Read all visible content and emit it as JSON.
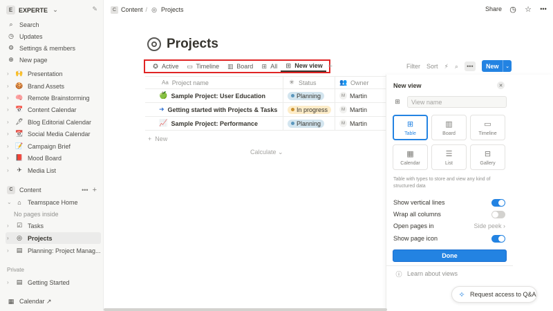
{
  "sidebar": {
    "workspace_badge": "E",
    "workspace_name": "EXPERTE",
    "top_items": [
      {
        "label": "Search",
        "icon": "⌕"
      },
      {
        "label": "Updates",
        "icon": "◷"
      },
      {
        "label": "Settings & members",
        "icon": "⚙"
      },
      {
        "label": "New page",
        "icon": "⊕"
      }
    ],
    "pages": [
      {
        "label": "Presentation",
        "icon": "🙌"
      },
      {
        "label": "Brand Assets",
        "icon": "🍪"
      },
      {
        "label": "Remote Brainstorming",
        "icon": "🧠"
      },
      {
        "label": "Content Calendar",
        "icon": "📅"
      },
      {
        "label": "Blog Editorial Calendar",
        "icon": "🖋"
      },
      {
        "label": "Social Media Calendar",
        "icon": "📆"
      },
      {
        "label": "Campaign Brief",
        "icon": "📝"
      },
      {
        "label": "Mood Board",
        "icon": "📕"
      },
      {
        "label": "Media List",
        "icon": "✈"
      }
    ],
    "teamspace": {
      "badge": "C",
      "label": "Content",
      "more": "•••",
      "add": "+",
      "items": [
        {
          "label": "Teamspace Home",
          "icon": "⌂"
        },
        {
          "label": "No pages inside",
          "icon": ""
        },
        {
          "label": "Tasks",
          "icon": "☑"
        },
        {
          "label": "Projects",
          "icon": "◎"
        },
        {
          "label": "Planning: Project Manag...",
          "icon": "▤"
        }
      ]
    },
    "private_label": "Private",
    "private_items": [
      {
        "label": "Getting Started",
        "icon": "▤"
      }
    ],
    "calendar_label": "Calendar ↗"
  },
  "topbar": {
    "crumb_badge": "C",
    "crumb_1": "Content",
    "sep": "/",
    "crumb_2": "Projects",
    "share": "Share"
  },
  "page": {
    "title": "Projects",
    "views": [
      {
        "label": "Active",
        "icon": "✪"
      },
      {
        "label": "Timeline",
        "icon": "▭"
      },
      {
        "label": "Board",
        "icon": "▥"
      },
      {
        "label": "All",
        "icon": "⊞"
      },
      {
        "label": "New view",
        "icon": "⊞"
      }
    ],
    "add_view": "+",
    "tools": {
      "filter": "Filter",
      "sort": "Sort",
      "bolt": "⚡",
      "search": "⌕",
      "more": "•••"
    },
    "new_button": "New",
    "new_arrow": "⌄"
  },
  "table": {
    "headers": {
      "name": "Project name",
      "name_icon": "Aa",
      "status": "Status",
      "owner": "Owner"
    },
    "rows": [
      {
        "icon": "🍏",
        "name": "Sample Project: User Education",
        "status": "Planning",
        "status_color": "#d3e5ef",
        "dot": "#5b97bd",
        "owner_initial": "M",
        "owner": "Martin"
      },
      {
        "icon": "➜",
        "name": "Getting started with Projects & Tasks",
        "status": "In progress",
        "status_color": "#fdecc8",
        "dot": "#cb912f",
        "owner_initial": "M",
        "owner": "Martin"
      },
      {
        "icon": "📈",
        "name": "Sample Project: Performance",
        "status": "Planning",
        "status_color": "#d3e5ef",
        "dot": "#5b97bd",
        "owner_initial": "M",
        "owner": "Martin"
      }
    ],
    "new_row": "New",
    "calculate": "Calculate ⌄"
  },
  "panel": {
    "title": "New view",
    "close": "✕",
    "name_placeholder": "View name",
    "layouts": [
      {
        "label": "Table",
        "icon": "⊞"
      },
      {
        "label": "Board",
        "icon": "▥"
      },
      {
        "label": "Timeline",
        "icon": "▭"
      },
      {
        "label": "Calendar",
        "icon": "▦"
      },
      {
        "label": "List",
        "icon": "☰"
      },
      {
        "label": "Gallery",
        "icon": "⊟"
      }
    ],
    "description": "Table with types to store and view any kind of structured data",
    "options": {
      "vertical_lines": "Show vertical lines",
      "wrap_columns": "Wrap all columns",
      "open_pages": "Open pages in",
      "open_pages_value": "Side peek ›",
      "page_icon": "Show page icon"
    },
    "done": "Done",
    "learn": "Learn about views"
  },
  "qa_button": "Request access to Q&A"
}
